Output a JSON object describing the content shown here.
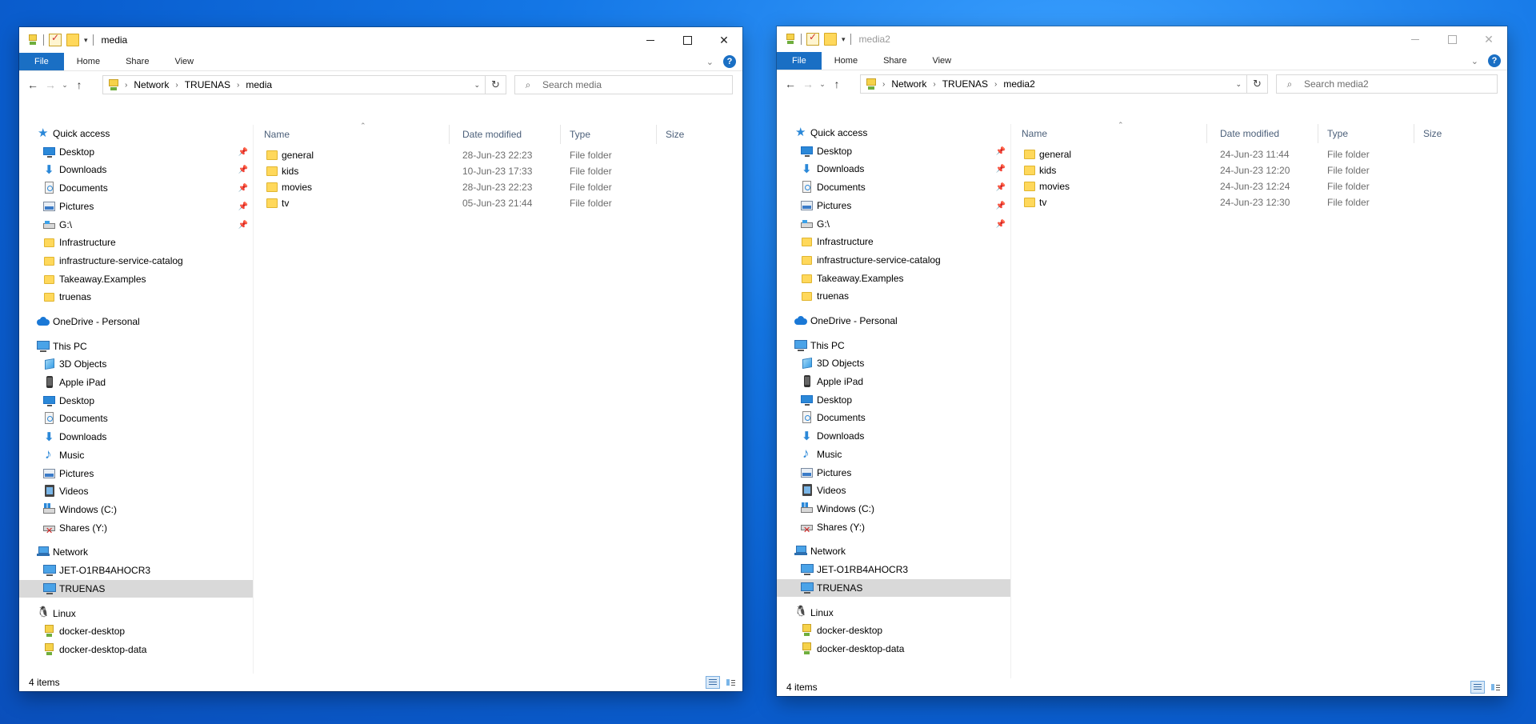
{
  "windows": [
    {
      "title": "media",
      "active": true,
      "ribbon_tabs": [
        "File",
        "Home",
        "Share",
        "View"
      ],
      "breadcrumb": [
        "Network",
        "TRUENAS",
        "media"
      ],
      "search_placeholder": "Search media",
      "columns": [
        "Name",
        "Date modified",
        "Type",
        "Size"
      ],
      "files": [
        {
          "name": "general",
          "date": "28-Jun-23 22:23",
          "type": "File folder"
        },
        {
          "name": "kids",
          "date": "10-Jun-23 17:33",
          "type": "File folder"
        },
        {
          "name": "movies",
          "date": "28-Jun-23 22:23",
          "type": "File folder"
        },
        {
          "name": "tv",
          "date": "05-Jun-23 21:44",
          "type": "File folder"
        }
      ],
      "status": "4 items"
    },
    {
      "title": "media2",
      "active": false,
      "ribbon_tabs": [
        "File",
        "Home",
        "Share",
        "View"
      ],
      "breadcrumb": [
        "Network",
        "TRUENAS",
        "media2"
      ],
      "search_placeholder": "Search media2",
      "columns": [
        "Name",
        "Date modified",
        "Type",
        "Size"
      ],
      "files": [
        {
          "name": "general",
          "date": "24-Jun-23 11:44",
          "type": "File folder"
        },
        {
          "name": "kids",
          "date": "24-Jun-23 12:20",
          "type": "File folder"
        },
        {
          "name": "movies",
          "date": "24-Jun-23 12:24",
          "type": "File folder"
        },
        {
          "name": "tv",
          "date": "24-Jun-23 12:30",
          "type": "File folder"
        }
      ],
      "status": "4 items"
    }
  ],
  "nav": [
    {
      "label": "Quick access",
      "icon": "star-icon",
      "level": 0,
      "pinned": false
    },
    {
      "label": "Desktop",
      "icon": "desktop-icon",
      "level": 1,
      "pinned": true
    },
    {
      "label": "Downloads",
      "icon": "download-icon",
      "level": 1,
      "pinned": true
    },
    {
      "label": "Documents",
      "icon": "documents-icon",
      "level": 1,
      "pinned": true
    },
    {
      "label": "Pictures",
      "icon": "pictures-icon",
      "level": 1,
      "pinned": true
    },
    {
      "label": "G:\\",
      "icon": "drive-icon",
      "level": 1,
      "pinned": true
    },
    {
      "label": "Infrastructure",
      "icon": "folder-icon",
      "level": 1,
      "pinned": false
    },
    {
      "label": "infrastructure-service-catalog",
      "icon": "folder-icon",
      "level": 1,
      "pinned": false
    },
    {
      "label": "Takeaway.Examples",
      "icon": "folder-icon",
      "level": 1,
      "pinned": false
    },
    {
      "label": "truenas",
      "icon": "folder-icon",
      "level": 1,
      "pinned": false
    },
    {
      "label": "OneDrive - Personal",
      "icon": "cloud-icon",
      "level": 0,
      "pinned": false,
      "gap": true
    },
    {
      "label": "This PC",
      "icon": "pc-icon",
      "level": 0,
      "pinned": false,
      "gap": true
    },
    {
      "label": "3D Objects",
      "icon": "cube-icon",
      "level": 1,
      "pinned": false
    },
    {
      "label": "Apple iPad",
      "icon": "ipad-icon",
      "level": 1,
      "pinned": false
    },
    {
      "label": "Desktop",
      "icon": "desktop-icon",
      "level": 1,
      "pinned": false
    },
    {
      "label": "Documents",
      "icon": "documents-icon",
      "level": 1,
      "pinned": false
    },
    {
      "label": "Downloads",
      "icon": "download-icon",
      "level": 1,
      "pinned": false
    },
    {
      "label": "Music",
      "icon": "music-icon",
      "level": 1,
      "pinned": false
    },
    {
      "label": "Pictures",
      "icon": "pictures-icon",
      "level": 1,
      "pinned": false
    },
    {
      "label": "Videos",
      "icon": "video-icon",
      "level": 1,
      "pinned": false
    },
    {
      "label": "Windows (C:)",
      "icon": "windows-drive-icon",
      "level": 1,
      "pinned": false
    },
    {
      "label": "Shares (Y:)",
      "icon": "network-drive-icon",
      "level": 1,
      "pinned": false
    },
    {
      "label": "Network",
      "icon": "network-icon",
      "level": 0,
      "pinned": false,
      "gap": true
    },
    {
      "label": "JET-O1RB4AHOCR3",
      "icon": "pc-icon",
      "level": 1,
      "pinned": false
    },
    {
      "label": "TRUENAS",
      "icon": "pc-icon",
      "level": 1,
      "pinned": false,
      "selected": true
    },
    {
      "label": "Linux",
      "icon": "linux-icon",
      "level": 0,
      "pinned": false,
      "gap": true
    },
    {
      "label": "docker-desktop",
      "icon": "linux-folder-icon",
      "level": 1,
      "pinned": false
    },
    {
      "label": "docker-desktop-data",
      "icon": "linux-folder-icon",
      "level": 1,
      "pinned": false
    }
  ],
  "colors": {
    "accent": "#1a6fc4",
    "selection": "#d9d9d9",
    "header_text": "#4c607a"
  }
}
